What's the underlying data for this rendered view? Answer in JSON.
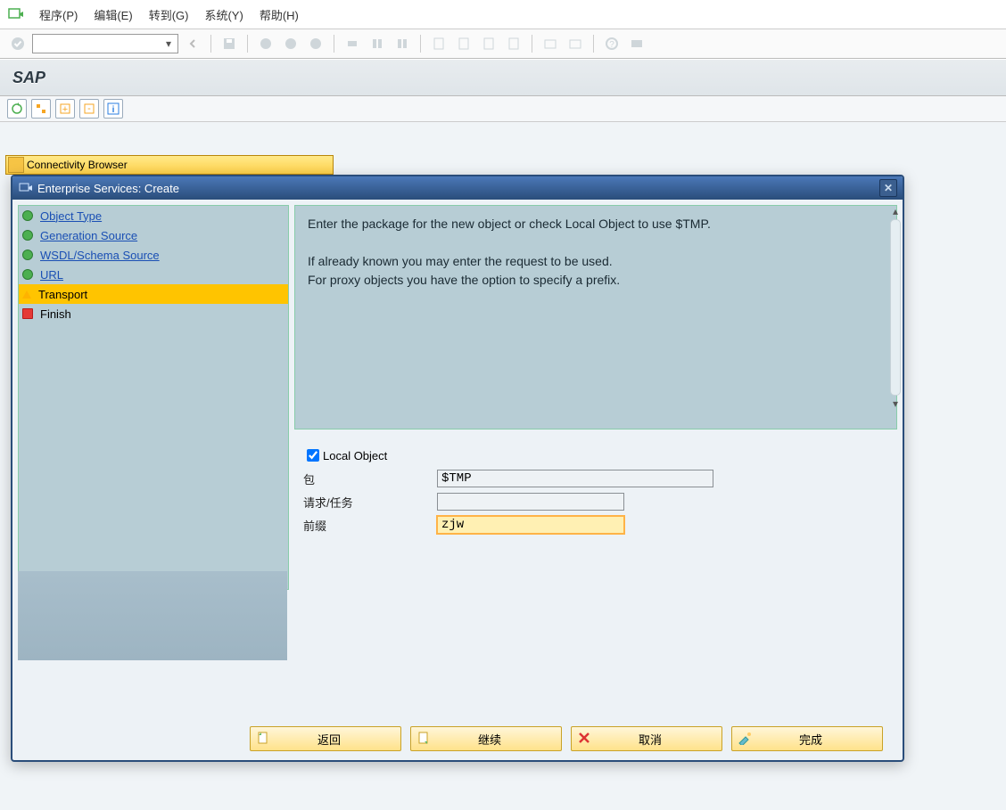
{
  "menu": {
    "program": "程序(P)",
    "edit": "编辑(E)",
    "goto": "转到(G)",
    "system": "系统(Y)",
    "help": "帮助(H)"
  },
  "app": {
    "title": "SAP",
    "connectivity_browser": "Connectivity Browser"
  },
  "dialog": {
    "title": "Enterprise Services: Create",
    "info_line1": "Enter the package for the new object or check Local Object to use $TMP.",
    "info_line2": "If already known you may enter the request to be used.",
    "info_line3": "For proxy objects you have the option to specify a prefix.",
    "steps": {
      "object_type": "Object Type",
      "generation_source": "Generation Source",
      "wsdl_source": "WSDL/Schema Source",
      "url": "URL",
      "transport": "Transport",
      "finish": "Finish"
    },
    "form": {
      "local_object_label": "Local Object",
      "local_object_checked": true,
      "package_label": "包",
      "package_value": "$TMP",
      "request_label": "请求/任务",
      "request_value": "",
      "prefix_label": "前缀",
      "prefix_value": "zjw"
    },
    "buttons": {
      "back": "返回",
      "continue": "继续",
      "cancel": "取消",
      "finish": "完成"
    }
  }
}
